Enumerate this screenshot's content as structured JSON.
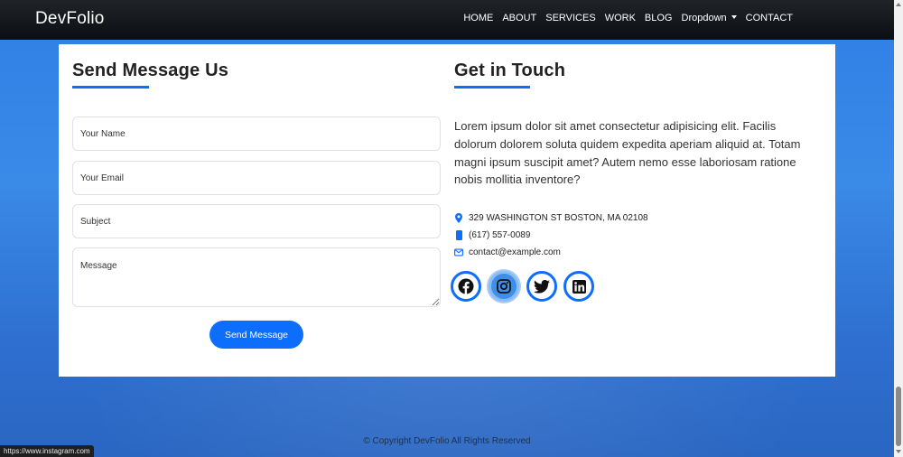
{
  "navbar": {
    "brand": "DevFolio",
    "links": [
      {
        "label": "HOME"
      },
      {
        "label": "ABOUT"
      },
      {
        "label": "SERVICES"
      },
      {
        "label": "WORK"
      },
      {
        "label": "BLOG"
      },
      {
        "label": "Dropdown"
      },
      {
        "label": "CONTACT"
      }
    ]
  },
  "form": {
    "title": "Send Message Us",
    "name_placeholder": "Your Name",
    "email_placeholder": "Your Email",
    "subject_placeholder": "Subject",
    "message_placeholder": "Message",
    "submit_label": "Send Message"
  },
  "contact": {
    "title": "Get in Touch",
    "intro": "Lorem ipsum dolor sit amet consectetur adipisicing elit. Facilis dolorum dolorem soluta quidem expedita aperiam aliquid at. Totam magni ipsum suscipit amet? Autem nemo esse laboriosam ratione nobis mollitia inventore?",
    "address": "329 WASHINGTON ST BOSTON, MA 02108",
    "phone": "(617) 557-0089",
    "email": "contact@example.com",
    "socials": [
      {
        "icon": "facebook-icon"
      },
      {
        "icon": "instagram-icon",
        "active": true
      },
      {
        "icon": "twitter-icon"
      },
      {
        "icon": "linkedin-icon"
      }
    ]
  },
  "footer": {
    "copyright": "© Copyright DevFolio  All Rights Reserved"
  },
  "statusbar": {
    "url": "https://www.instagram.com"
  },
  "colors": {
    "accent": "#0d6efd",
    "navbar": "#0b0f13",
    "background": "#2f7fe6"
  }
}
